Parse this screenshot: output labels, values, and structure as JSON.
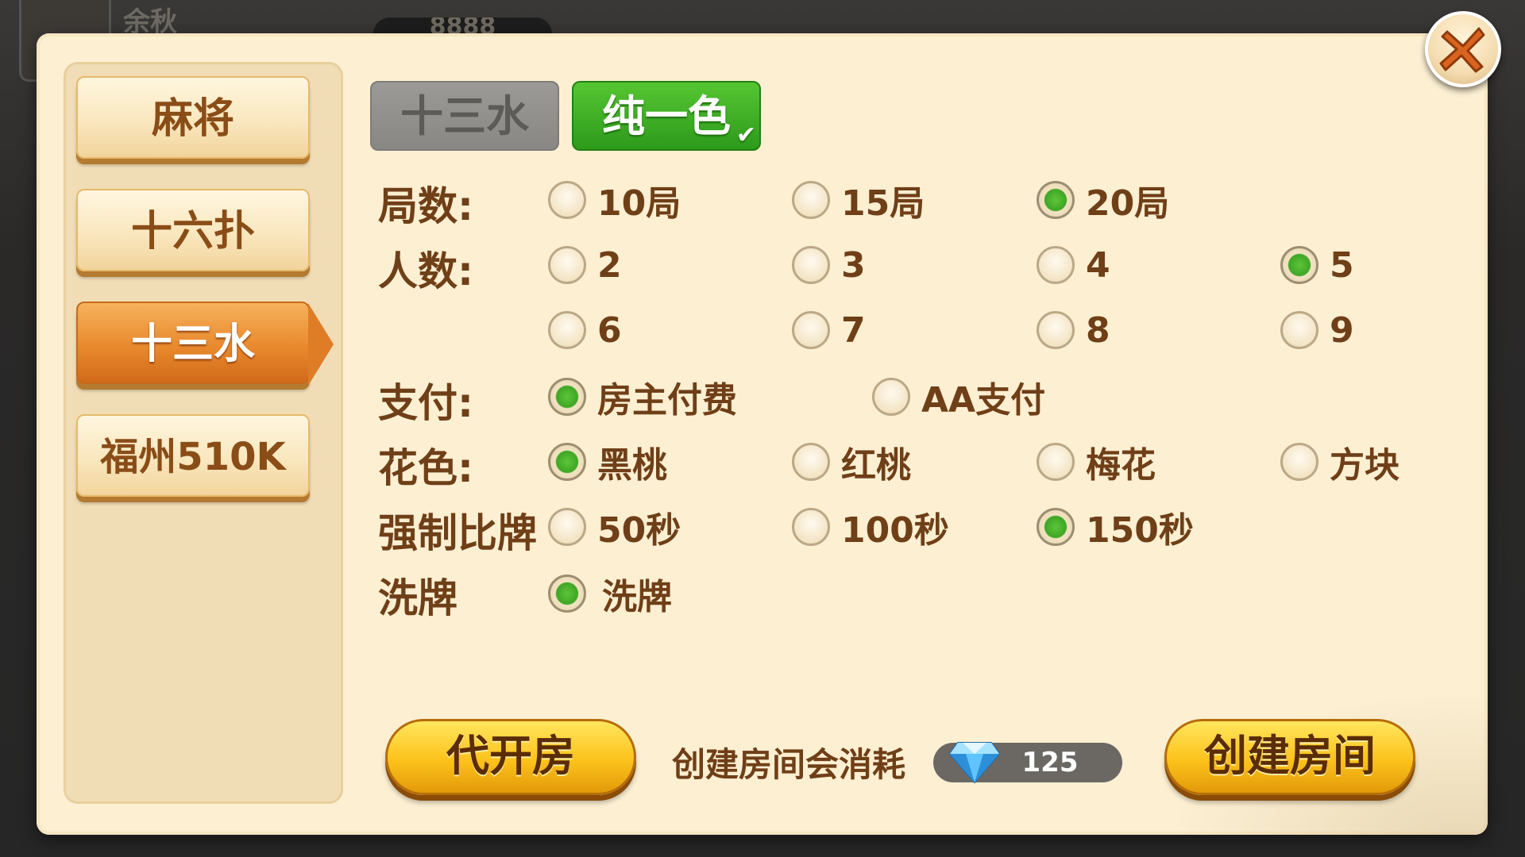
{
  "background": {
    "player_name": "余秋",
    "coin_display": "8888"
  },
  "sidebar": {
    "items": [
      {
        "label": "麻将",
        "active": false
      },
      {
        "label": "十六扑",
        "active": false
      },
      {
        "label": "十三水",
        "active": true
      },
      {
        "label": "福州510K",
        "active": false
      }
    ]
  },
  "tabs": [
    {
      "label": "十三水",
      "active": false
    },
    {
      "label": "纯一色",
      "active": true,
      "check_icon": "checkmark-icon"
    }
  ],
  "settings": {
    "rounds": {
      "label": "局数:",
      "options": [
        "10局",
        "15局",
        "20局"
      ],
      "selected": "20局"
    },
    "players": {
      "label": "人数:",
      "options": [
        "2",
        "3",
        "4",
        "5",
        "6",
        "7",
        "8",
        "9"
      ],
      "selected": "5"
    },
    "payment": {
      "label": "支付:",
      "options": [
        "房主付费",
        "AA支付"
      ],
      "selected": "房主付费"
    },
    "suit": {
      "label": "花色:",
      "options": [
        "黑桃",
        "红桃",
        "梅花",
        "方块"
      ],
      "selected": "黑桃"
    },
    "force_compare": {
      "label": "强制比牌",
      "options": [
        "50秒",
        "100秒",
        "150秒"
      ],
      "selected": "150秒"
    },
    "shuffle": {
      "label": "洗牌",
      "options": [
        "洗牌"
      ],
      "selected": "洗牌"
    }
  },
  "footer": {
    "proxy_button": "代开房",
    "cost_text": "创建房间会消耗",
    "cost_icon": "diamond-icon",
    "cost_value": "125",
    "create_button": "创建房间"
  },
  "close_icon": "close-icon",
  "colors": {
    "panel": "#fcefd2",
    "active_tab": "#3aa824",
    "active_side": "#e9892d",
    "text_brown": "#6f3f18",
    "radio_on": "#4cb52d"
  }
}
